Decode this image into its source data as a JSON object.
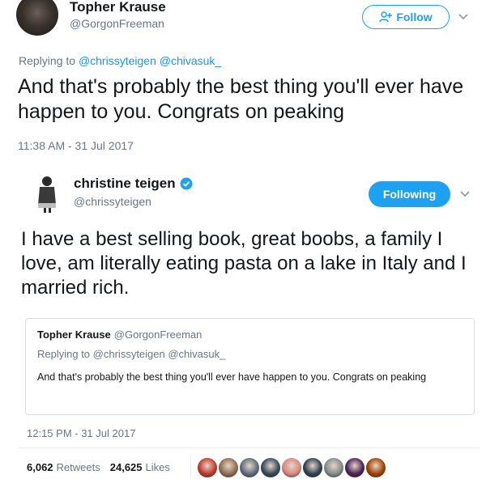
{
  "tweet1": {
    "name": "Topher Krause",
    "handle": "@GorgonFreeman",
    "follow_label": "Follow",
    "replying_prefix": "Replying to",
    "replying_mentions": "@chrissyteigen @chivasuk_",
    "text": "And that's probably the best thing you'll ever have happen to you. Congrats on peaking",
    "timestamp": "11:38 AM - 31 Jul 2017",
    "icons": [
      "avatar",
      "add-user-icon",
      "chevron-down-icon"
    ]
  },
  "tweet2": {
    "name": "christine teigen",
    "handle": "@chrissyteigen",
    "following_label": "Following",
    "text": "I have a best selling book, great boobs, a family I love, am literally eating pasta on a lake in Italy and I married rich.",
    "timestamp": "12:15 PM - 31 Jul 2017",
    "retweets_count": "6,062",
    "retweets_label": "Retweets",
    "likes_count": "24,625",
    "likes_label": "Likes",
    "icons": [
      "avatar",
      "verified-badge-icon",
      "chevron-down-icon"
    ]
  },
  "quoted": {
    "name": "Topher Krause",
    "handle": "@GorgonFreeman",
    "replying_prefix": "Replying to",
    "replying_mentions": "@chrissyteigen @chivasuk_",
    "text": "And that's probably the best thing you'll ever have happen to you. Congrats on peaking"
  },
  "colors": {
    "accent": "#1da1f2",
    "link": "#1b95e0",
    "secondary_text": "#657786",
    "border": "#d7dfe6"
  },
  "likers": [
    {
      "color": "#c0392b"
    },
    {
      "color": "#8e6e53"
    },
    {
      "color": "#5d6d7e"
    },
    {
      "color": "#34495e"
    },
    {
      "color": "#d98880"
    },
    {
      "color": "#2e4053"
    },
    {
      "color": "#7f8c8d"
    },
    {
      "color": "#4a235a"
    },
    {
      "color": "#a04000"
    }
  ]
}
